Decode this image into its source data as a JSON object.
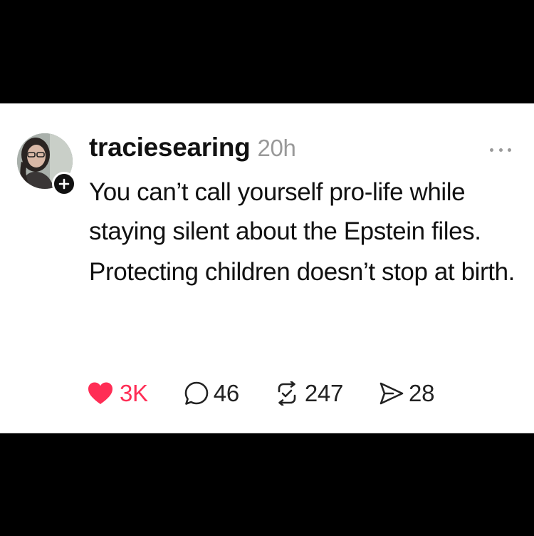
{
  "post": {
    "username": "traciesearing",
    "timestamp": "20h",
    "paragraphs": [
      "You can’t call yourself pro-life while staying silent about the Epstein files.",
      "Protecting children doesn’t stop at birth."
    ],
    "actions": {
      "like_count": "3K",
      "reply_count": "46",
      "repost_count": "247",
      "share_count": "28"
    }
  },
  "icons": {
    "avatar": "profile-photo",
    "follow": "plus-icon",
    "more": "ellipsis-icon",
    "like": "heart-icon",
    "reply": "speech-bubble-icon",
    "repost": "repost-arrows-icon",
    "share": "paper-plane-icon"
  },
  "colors": {
    "like_active": "#ff2d55",
    "text": "#111111",
    "muted": "#999999",
    "background": "#ffffff",
    "letterbox": "#000000"
  }
}
